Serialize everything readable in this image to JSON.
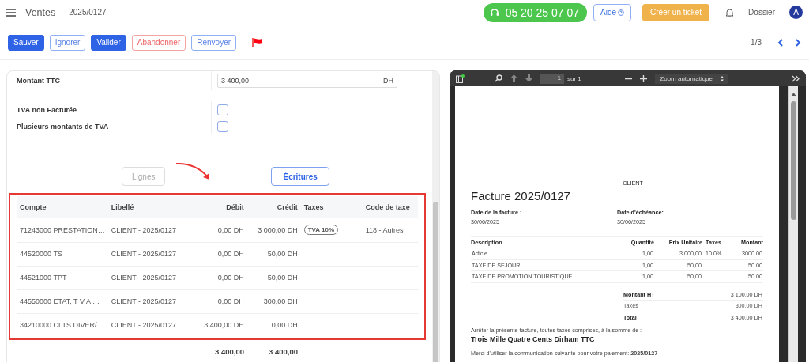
{
  "header": {
    "app": "Ventes",
    "record": "2025/0127",
    "phone": "05 20 25 07 07",
    "help": "Aide",
    "ticket": "Créer un ticket",
    "company": "Dossier",
    "avatar": "A"
  },
  "toolbar": {
    "buttons": [
      {
        "label": "Sauver",
        "kind": "primary"
      },
      {
        "label": "Ignorer",
        "kind": "outline"
      },
      {
        "label": "Valider",
        "kind": "primary"
      },
      {
        "label": "Abandonner",
        "kind": "danger"
      },
      {
        "label": "Renvoyer",
        "kind": "outline"
      }
    ],
    "pager": "1/3"
  },
  "form": {
    "amount": {
      "label": "Montant TTC",
      "value": "3 400,00",
      "currency": "DH"
    },
    "checks": [
      {
        "label": "TVA non Facturée",
        "checked": false
      },
      {
        "label": "Plusieurs montants de TVA",
        "checked": false
      }
    ]
  },
  "tabs": [
    {
      "label": "Lignes",
      "selected": false
    },
    {
      "label": "Écritures",
      "selected": true
    }
  ],
  "table": {
    "columns": [
      "Compte",
      "Libellé",
      "Débit",
      "Crédit",
      "Taxes",
      "Code de taxe"
    ],
    "rows": [
      {
        "account": "71243000 PRESTATION…",
        "label": "CLIENT - 2025/0127",
        "debit": "0,00 DH",
        "credit": "3 000,00 DH",
        "tax": "TVA 10%",
        "tax_code": "118 - Autres"
      },
      {
        "account": "44520000 TS",
        "label": "CLIENT - 2025/0127",
        "debit": "0,00 DH",
        "credit": "50,00 DH"
      },
      {
        "account": "44521000 TPT",
        "label": "CLIENT - 2025/0127",
        "debit": "0,00 DH",
        "credit": "50,00 DH"
      },
      {
        "account": "44550000 ETAT, T V A …",
        "label": "CLIENT - 2025/0127",
        "debit": "0,00 DH",
        "credit": "300,00 DH"
      },
      {
        "account": "34210000 CLTS DIVER/…",
        "label": "CLIENT - 2025/0127",
        "debit": "3 400,00 DH",
        "credit": "0,00 DH"
      }
    ],
    "totals": {
      "debit": "3 400,00",
      "credit": "3 400,00"
    }
  },
  "pdf": {
    "page": "1",
    "of": "sur 1",
    "zoom": "Zoom automatique",
    "doc": {
      "client": "CLIENT",
      "title": "Facture 2025/0127",
      "dates": [
        {
          "label": "Date de la facture :",
          "value": "30/06/2025"
        },
        {
          "label": "Date d'échéance:",
          "value": "30/06/2025"
        }
      ],
      "columns": [
        "Description",
        "Quantité",
        "Prix Unitaire",
        "Taxes",
        "Montant"
      ],
      "lines": [
        {
          "description": "Article",
          "quantity": "1,00",
          "unit_price": "3 000,00",
          "taxes": "10.0%",
          "amount": "3000.00"
        },
        {
          "description": "TAXE DE SEJOUR",
          "quantity": "1,00",
          "unit_price": "50,00",
          "amount": "50.00"
        },
        {
          "description": "TAXE DE PROMOTION TOURISTIQUE",
          "quantity": "1,00",
          "unit_price": "50,00",
          "amount": "50.00"
        }
      ],
      "summary": [
        {
          "label": "Montant HT",
          "value": "3 100,00 DH",
          "kind": "strong"
        },
        {
          "label": "Taxes",
          "value": "300,00 DH",
          "kind": "plain"
        },
        {
          "label": "Total",
          "value": "3 400,00 DH",
          "kind": "strong"
        }
      ],
      "words_intro": "Arrêter la présente facture, toutes taxes comprises, à la somme de :",
      "words": "Trois Mille Quatre Cents Dirham TTC",
      "payment": "Merci d'utiliser la communication suivante pour votre paiement: **2025/0127**"
    }
  }
}
